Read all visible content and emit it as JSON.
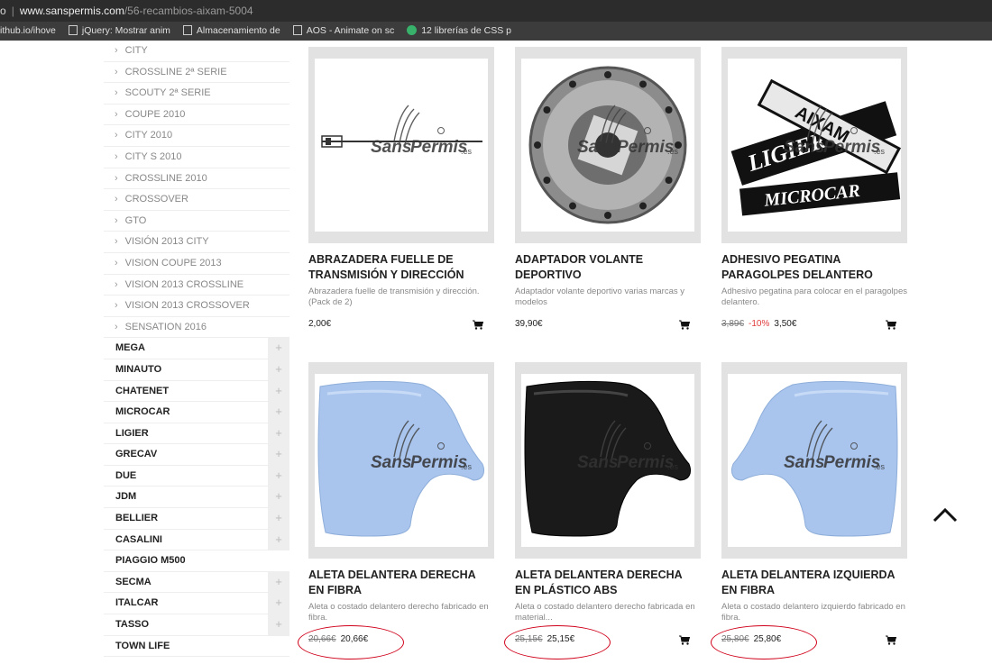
{
  "browser": {
    "url_prefix": "o",
    "url_host": "www.sanspermis.com",
    "url_path": "/56-recambios-aixam-5004",
    "bookmarks": [
      {
        "label": "ithub.io/ihove",
        "icon": "none"
      },
      {
        "label": "jQuery: Mostrar anim",
        "icon": "page-icon"
      },
      {
        "label": "Almacenamiento de",
        "icon": "page-icon"
      },
      {
        "label": "AOS - Animate on sc",
        "icon": "page-icon"
      },
      {
        "label": "12 librerías de CSS p",
        "icon": "green-circle-icon"
      }
    ]
  },
  "sidebar": {
    "subitems": [
      "CITY",
      "CROSSLINE 2ª Serie",
      "SCOUTY 2ª Serie",
      "COUPE 2010",
      "CITY 2010",
      "CITY S 2010",
      "CROSSLINE 2010",
      "CROSSOVER",
      "GTO",
      "VISIÓN 2013 CITY",
      "VISION COUPE 2013",
      "VISION 2013 CROSSLINE",
      "VISION 2013 CROSSOVER",
      "SENSATION 2016"
    ],
    "categories": [
      {
        "label": "MEGA",
        "plus": true
      },
      {
        "label": "MINAUTO",
        "plus": true
      },
      {
        "label": "CHATENET",
        "plus": true
      },
      {
        "label": "MICROCAR",
        "plus": true
      },
      {
        "label": "LIGIER",
        "plus": true
      },
      {
        "label": "GRECAV",
        "plus": true
      },
      {
        "label": "DUE",
        "plus": true
      },
      {
        "label": "JDM",
        "plus": true
      },
      {
        "label": "BELLIER",
        "plus": true
      },
      {
        "label": "CASALINI",
        "plus": true
      },
      {
        "label": "PIAGGIO M500",
        "plus": false
      },
      {
        "label": "SECMA",
        "plus": true
      },
      {
        "label": "ITALCAR",
        "plus": true
      },
      {
        "label": "TASSO",
        "plus": true
      },
      {
        "label": "TOWN LIFE",
        "plus": false
      }
    ],
    "plus_symbol": "+",
    "chevron": "›"
  },
  "products": [
    {
      "title": "ABRAZADERA FUELLE DE TRANSMISIÓN Y DIRECCIÓN",
      "desc": "Abrazadera fuelle de transmisión y dirección. (Pack de 2)",
      "old_price": "",
      "discount": "",
      "price": "2,00€",
      "image": "cable",
      "annotated": false
    },
    {
      "title": "ADAPTADOR VOLANTE DEPORTIVO",
      "desc": "Adaptador volante deportivo varias marcas y modelos",
      "old_price": "",
      "discount": "",
      "price": "39,90€",
      "image": "hub",
      "annotated": false
    },
    {
      "title": "ADHESIVO PEGATINA PARAGOLPES DELANTERO",
      "desc": "Adhesivo pegatina para colocar en el paragolpes delantero.",
      "old_price": "3,89€",
      "discount": "-10%",
      "price": "3,50€",
      "image": "sticker",
      "annotated": false
    },
    {
      "title": "ALETA DELANTERA DERECHA EN FIBRA",
      "desc": "Aleta o costado delantero derecho fabricado en fibra.",
      "old_price": "20,66€",
      "discount": "",
      "price": "20,66€",
      "image": "fender-blue-right",
      "annotated": true
    },
    {
      "title": "ALETA DELANTERA DERECHA EN PLÁSTICO ABS",
      "desc": "Aleta o costado delantero derecho fabricada en material...",
      "old_price": "25,15€",
      "discount": "",
      "price": "25,15€",
      "image": "fender-black",
      "annotated": true
    },
    {
      "title": "ALETA DELANTERA IZQUIERDA EN FIBRA",
      "desc": "Aleta o costado delantero izquierdo fabricado en fibra.",
      "old_price": "25,80€",
      "discount": "",
      "price": "25,80€",
      "image": "fender-blue-left",
      "annotated": true
    }
  ],
  "watermark": {
    "sans": "Sans",
    "permis": "Permis",
    "es": ".es"
  },
  "sticker_text": {
    "top": "LIGIER",
    "mid": "AIXAM",
    "bottom": "MICROCAR"
  },
  "icons": {
    "cart": "shopping-cart-icon",
    "totop": "chevron-up-icon"
  },
  "colors": {
    "annotation": "#d0021b",
    "fender_blue": "#a9c5ee",
    "discount": "#e23b3b"
  }
}
